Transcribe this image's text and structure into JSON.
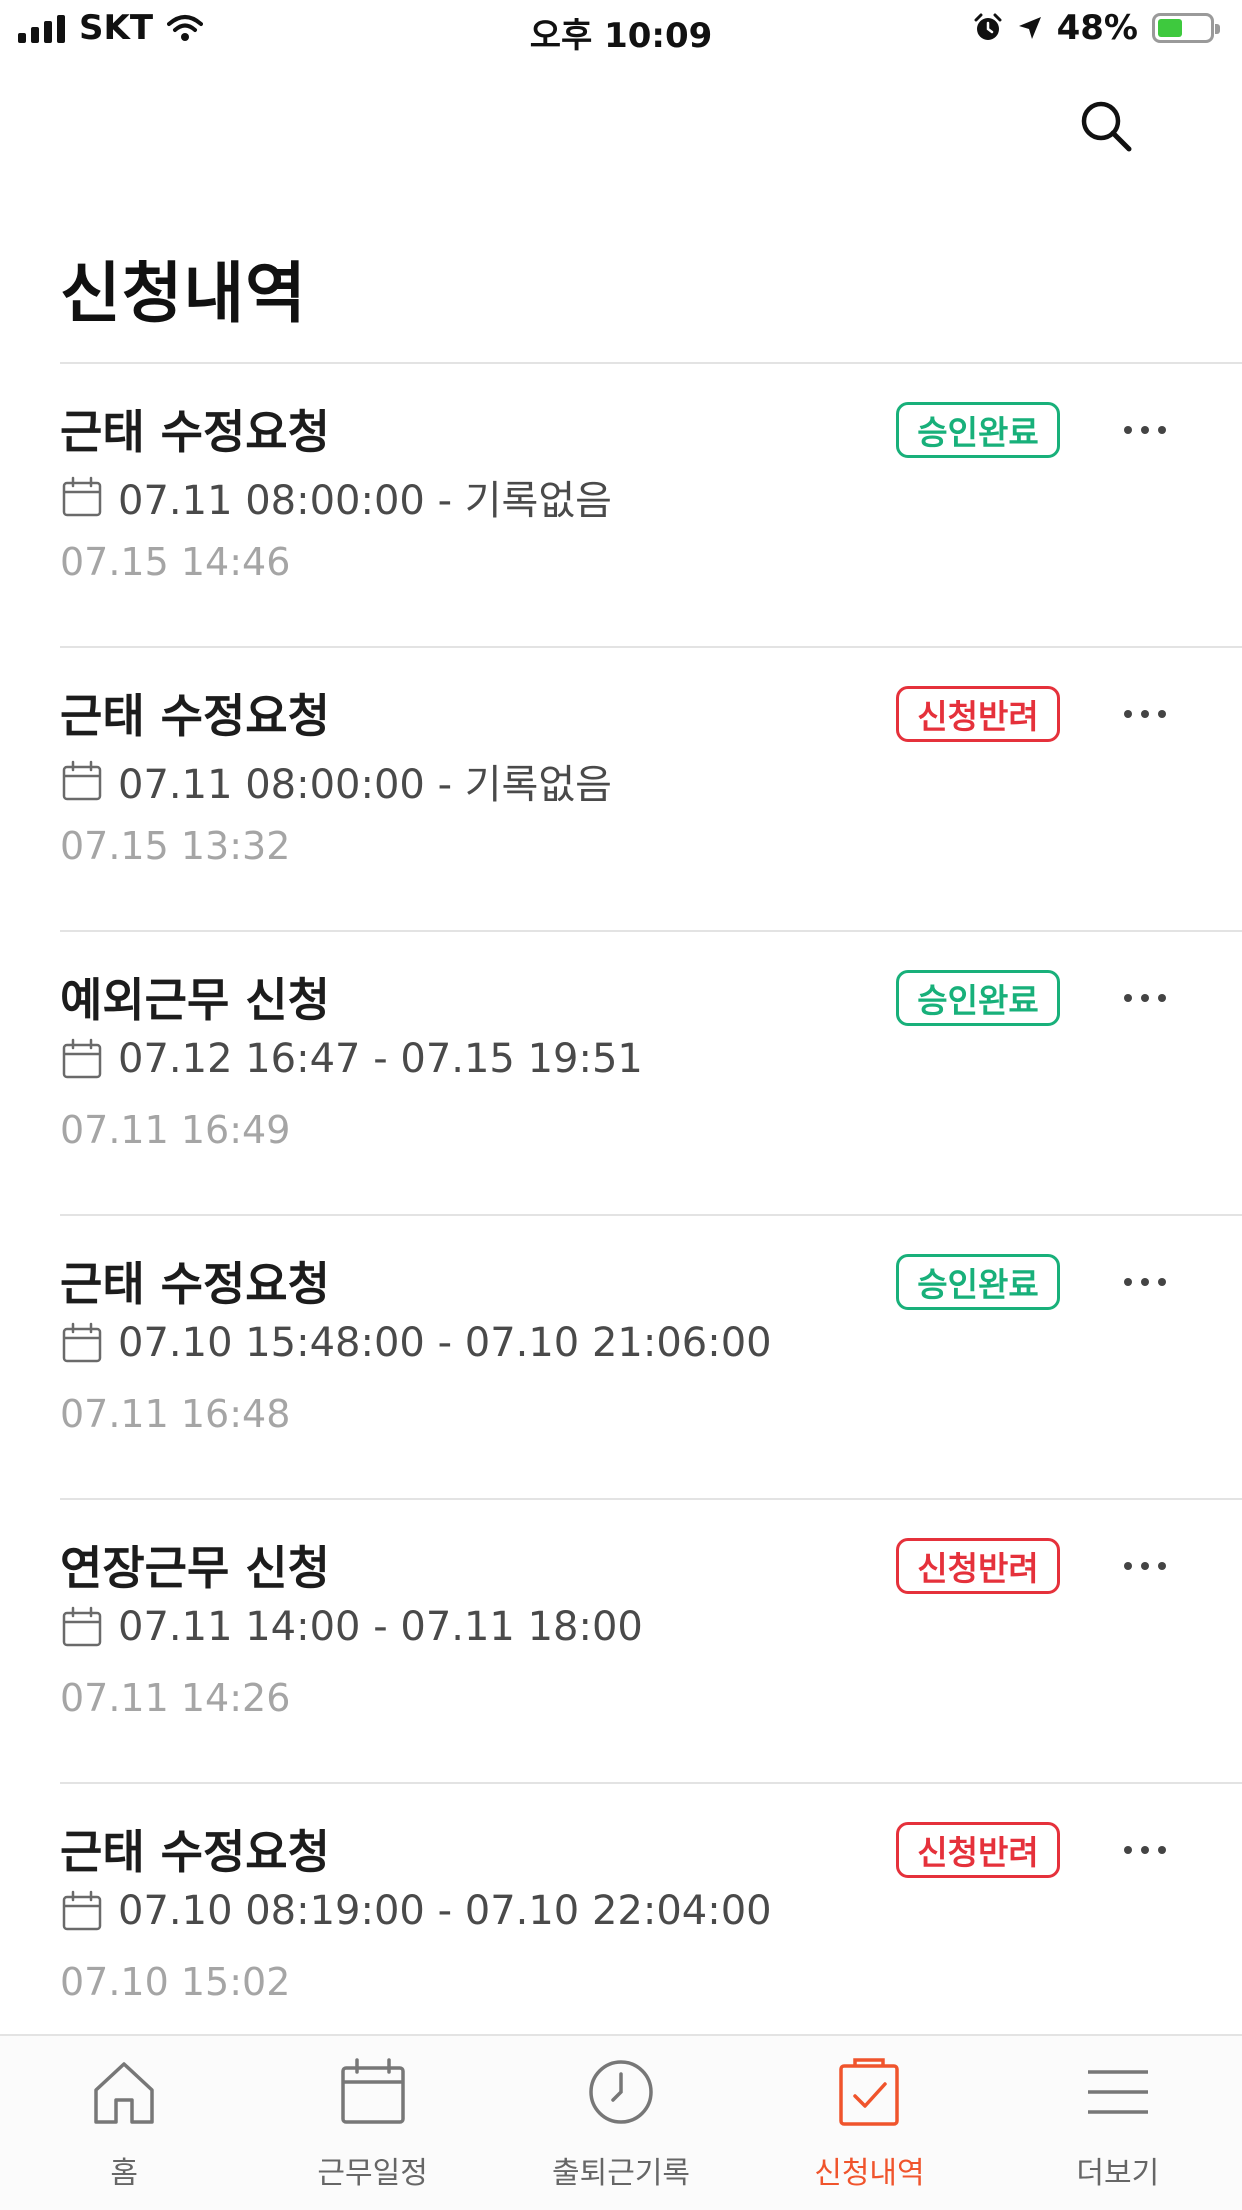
{
  "status_bar": {
    "carrier": "SKT",
    "time": "오후 10:09",
    "battery": "48%",
    "battery_level": 0.48
  },
  "header": {
    "title": "신청내역",
    "search_icon": "search-icon"
  },
  "requests": [
    {
      "title": "근태 수정요청",
      "status": "승인완료",
      "status_type": "approved",
      "range": "07.11 08:00:00 - 기록없음",
      "submitted": "07.15 14:46"
    },
    {
      "title": "근태 수정요청",
      "status": "신청반려",
      "status_type": "rejected",
      "range": "07.11 08:00:00 - 기록없음",
      "submitted": "07.15 13:32"
    },
    {
      "title": "예외근무 신청",
      "status": "승인완료",
      "status_type": "approved",
      "range": "07.12 16:47 - 07.15 19:51",
      "submitted": "07.11 16:49"
    },
    {
      "title": "근태 수정요청",
      "status": "승인완료",
      "status_type": "approved",
      "range": "07.10 15:48:00 - 07.10 21:06:00",
      "submitted": "07.11 16:48"
    },
    {
      "title": "연장근무 신청",
      "status": "신청반려",
      "status_type": "rejected",
      "range": "07.11 14:00 - 07.11 18:00",
      "submitted": "07.11 14:26"
    },
    {
      "title": "근태 수정요청",
      "status": "신청반려",
      "status_type": "rejected",
      "range": "07.10 08:19:00 - 07.10 22:04:00",
      "submitted": "07.10 15:02"
    }
  ],
  "tab_bar": {
    "tabs": [
      {
        "label": "홈",
        "icon": "home-icon",
        "active": false
      },
      {
        "label": "근무일정",
        "icon": "calendar-icon",
        "active": false
      },
      {
        "label": "출퇴근기록",
        "icon": "clock-icon",
        "active": false
      },
      {
        "label": "신청내역",
        "icon": "checklist-icon",
        "active": true
      },
      {
        "label": "더보기",
        "icon": "menu-icon",
        "active": false
      }
    ]
  },
  "colors": {
    "approved": "#18b07a",
    "rejected": "#e5313b",
    "active_tab": "#f0542c",
    "secondary_text": "#a5a5a5"
  }
}
